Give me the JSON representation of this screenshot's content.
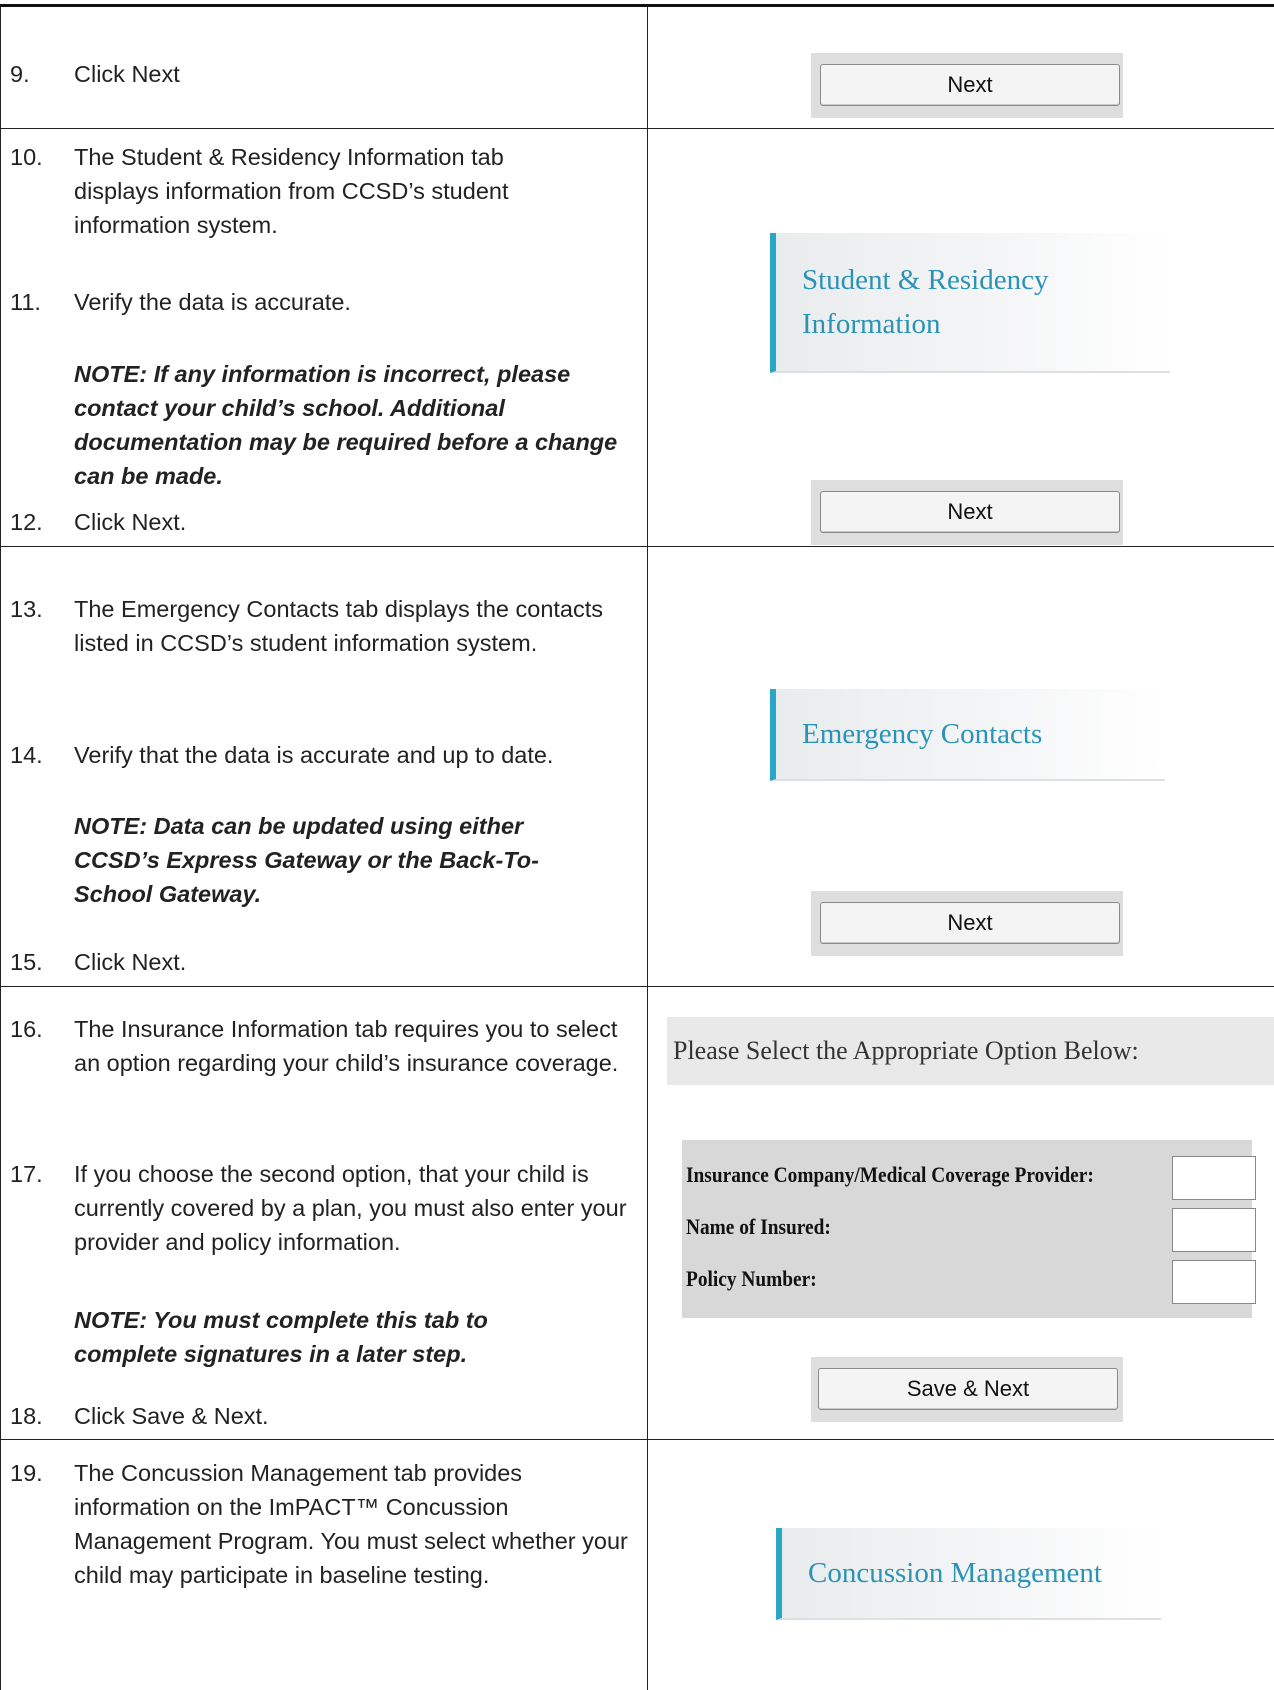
{
  "steps": [
    {
      "num": "9.",
      "text": "Click Next"
    },
    {
      "num": "10.",
      "text": "The Student & Residency Information tab displays information from CCSD’s student information system."
    },
    {
      "num": "11.",
      "text": "Verify the data is accurate."
    },
    {
      "note": "NOTE: If any information is incorrect, please contact your child’s school. Additional documentation may be required before a change can be made."
    },
    {
      "num": "12.",
      "text": "Click Next."
    },
    {
      "num": "13.",
      "text": "The Emergency Contacts tab displays the contacts listed in CCSD’s student information system."
    },
    {
      "num": "14.",
      "text": "Verify that the data is accurate and up to date."
    },
    {
      "note": "NOTE: Data can be updated using either CCSD’s Express Gateway or the Back-To-School Gateway."
    },
    {
      "num": "15.",
      "text": "Click Next."
    },
    {
      "num": "16.",
      "text": "The Insurance Information tab requires you to select an option regarding your child’s insurance coverage."
    },
    {
      "num": "17.",
      "text": "If you choose the second option, that your child is currently covered by a plan, you must also enter your provider and policy information."
    },
    {
      "note": "NOTE: You must complete this tab to complete signatures in a later step."
    },
    {
      "num": "18.",
      "text": "Click Save & Next."
    },
    {
      "num": "19.",
      "text": "The Concussion Management tab provides information on the ImPACT™ Concussion Management Program. You must select whether your child may participate in baseline testing."
    }
  ],
  "ui": {
    "next_label": "Next",
    "save_next_label": "Save & Next",
    "tab_student_residency": "Student & Residency Information",
    "tab_emergency_contacts": "Emergency Contacts",
    "tab_concussion": "Concussion Management",
    "insurance_prompt": "Please Select the Appropriate Option Below:",
    "insurance_fields": [
      "Insurance Company/Medical Coverage Provider:",
      "Name of Insured:",
      "Policy Number:"
    ]
  },
  "colors": {
    "tab_accent": "#2aa6c8",
    "tab_text": "#2a93b6"
  }
}
